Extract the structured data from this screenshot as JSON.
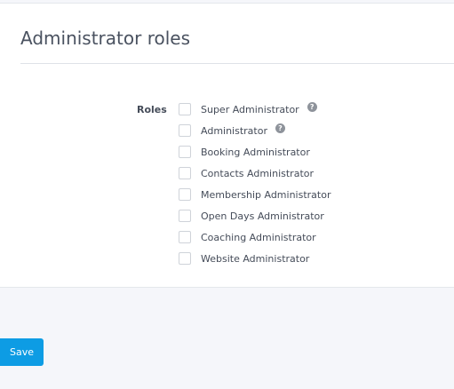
{
  "page": {
    "title": "Administrator roles"
  },
  "roles_field": {
    "label": "Roles",
    "options": [
      {
        "label": "Super Administrator",
        "checked": false,
        "help": "?"
      },
      {
        "label": "Administrator",
        "checked": false,
        "help": "?"
      },
      {
        "label": "Booking Administrator",
        "checked": false
      },
      {
        "label": "Contacts Administrator",
        "checked": false
      },
      {
        "label": "Membership Administrator",
        "checked": false
      },
      {
        "label": "Open Days Administrator",
        "checked": false
      },
      {
        "label": "Coaching Administrator",
        "checked": false
      },
      {
        "label": "Website Administrator",
        "checked": false
      }
    ]
  },
  "actions": {
    "save_label": "Save"
  },
  "colors": {
    "accent": "#0d9ce4",
    "background": "#f5f6fa",
    "panel": "#ffffff",
    "help_icon": "#8e939b"
  },
  "icons": {
    "help": "question-circle-icon"
  }
}
